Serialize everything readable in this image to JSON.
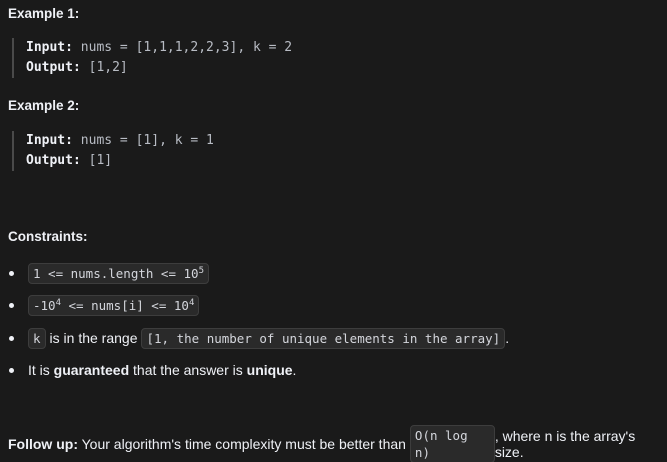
{
  "example1": {
    "heading": "Example 1:",
    "input_label": "Input:",
    "input_value": "nums = [1,1,1,2,2,3], k = 2",
    "output_label": "Output:",
    "output_value": "[1,2]"
  },
  "example2": {
    "heading": "Example 2:",
    "input_label": "Input:",
    "input_value": "nums = [1], k = 1",
    "output_label": "Output:",
    "output_value": "[1]"
  },
  "constraints": {
    "heading": "Constraints:",
    "c1_code_pre": "1 <= nums.length <= 10",
    "c1_sup": "5",
    "c2_code_a": "-10",
    "c2_sup_a": "4",
    "c2_code_b": " <= nums[i] <= 10",
    "c2_sup_b": "4",
    "c3_code_k": "k",
    "c3_text": "is in the range",
    "c3_code_range": "[1, the number of unique elements in the array]",
    "c3_end": ".",
    "c4_pre": "It is ",
    "c4_bold1": "guaranteed",
    "c4_mid": " that the answer is ",
    "c4_bold2": "unique",
    "c4_end": "."
  },
  "followup": {
    "label": "Follow up:",
    "text_pre": " Your algorithm's time complexity must be better than",
    "code": "O(n log n)",
    "text_post": ", where n is the array's size."
  }
}
